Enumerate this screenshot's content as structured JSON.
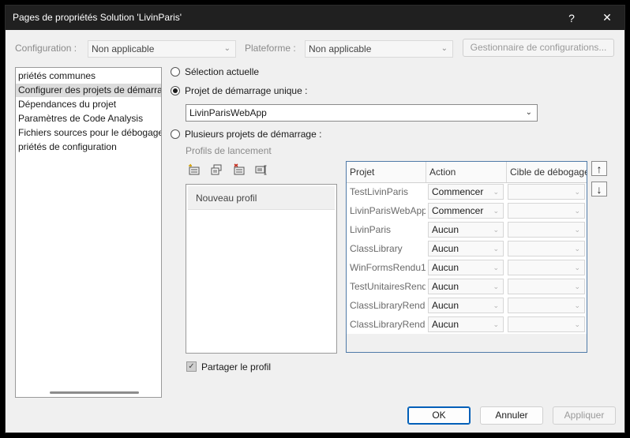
{
  "window": {
    "title": "Pages de propriétés Solution 'LivinParis'",
    "help": "?",
    "close": "✕"
  },
  "config": {
    "configuration_label": "Configuration :",
    "configuration_value": "Non applicable",
    "platform_label": "Plateforme :",
    "platform_value": "Non applicable",
    "manager_button": "Gestionnaire de configurations..."
  },
  "sidebar": {
    "items": [
      {
        "label": "priétés communes"
      },
      {
        "label": "Configurer des projets de démarrage"
      },
      {
        "label": "Dépendances du projet"
      },
      {
        "label": "Paramètres de Code Analysis"
      },
      {
        "label": "Fichiers sources pour le débogage"
      },
      {
        "label": "priétés de configuration"
      }
    ]
  },
  "startup": {
    "current_selection": "Sélection actuelle",
    "single_startup": "Projet de démarrage unique :",
    "single_value": "LivinParisWebApp",
    "multiple_startup": "Plusieurs projets de démarrage :",
    "profiles_label": "Profils de lancement",
    "new_profile": "Nouveau profil",
    "share_profile": "Partager le profil"
  },
  "grid": {
    "headers": {
      "project": "Projet",
      "action": "Action",
      "target": "Cible de débogage"
    },
    "rows": [
      {
        "project": "TestLivinParis",
        "action": "Commencer"
      },
      {
        "project": "LivinParisWebApp",
        "action": "Commencer"
      },
      {
        "project": "LivinParis",
        "action": "Aucun"
      },
      {
        "project": "ClassLibrary",
        "action": "Aucun"
      },
      {
        "project": "WinFormsRendu1",
        "action": "Aucun"
      },
      {
        "project": "TestUnitairesRendu",
        "action": "Aucun"
      },
      {
        "project": "ClassLibraryRendu",
        "action": "Aucun"
      },
      {
        "project": "ClassLibraryRendu",
        "action": "Aucun"
      }
    ]
  },
  "buttons": {
    "ok": "OK",
    "cancel": "Annuler",
    "apply": "Appliquer"
  },
  "icons": {
    "up": "↑",
    "down": "↓",
    "chevron": "⌄",
    "check": "✓"
  }
}
